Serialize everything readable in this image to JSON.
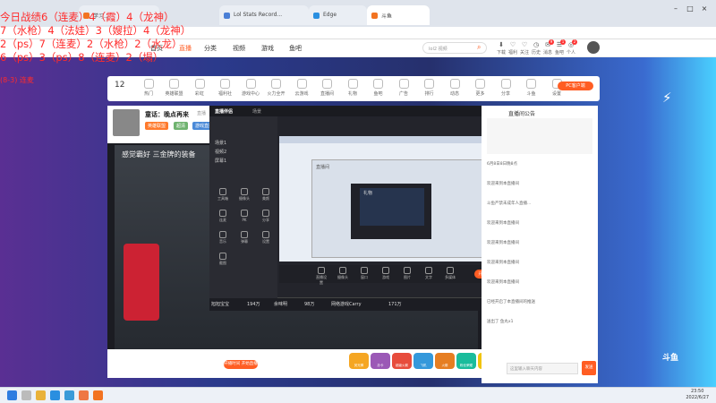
{
  "browser": {
    "tabs": [
      {
        "label": "学习..."
      },
      {
        "label": "Lol Stats Record..."
      },
      {
        "label": "Edge"
      },
      {
        "label": "斗鱼"
      }
    ]
  },
  "site_header": {
    "nav": [
      "首页",
      "直播",
      "分类",
      "视频",
      "游戏",
      "鱼吧"
    ],
    "search_placeholder": "lol2 视频",
    "icons": [
      {
        "label": "下载",
        "glyph": "⬇",
        "badge": ""
      },
      {
        "label": "福利",
        "glyph": "♡",
        "badge": ""
      },
      {
        "label": "关注",
        "glyph": "♡",
        "badge": ""
      },
      {
        "label": "历史",
        "glyph": "◷",
        "badge": ""
      },
      {
        "label": "消息",
        "glyph": "✉",
        "badge": "9"
      },
      {
        "label": "鱼吧",
        "glyph": "☰",
        "badge": "1"
      },
      {
        "label": "个人",
        "glyph": "◎",
        "badge": "2"
      }
    ]
  },
  "category_strip": {
    "count": "12",
    "items": [
      "热门",
      "英雄联盟",
      "彩虹",
      "福利社",
      "游戏中心",
      "火力全开",
      "云游戏",
      "直播间",
      "礼物",
      "鱼吧",
      "广告",
      "排行",
      "动态",
      "更多",
      "分享",
      "斗鱼",
      "设置"
    ],
    "pc_button": "PC客户端"
  },
  "anchor": {
    "name": "童话：晚点再来",
    "room": "直播",
    "follow": "关注",
    "tags": [
      "英雄联盟",
      "超清",
      "游戏直播"
    ]
  },
  "video": {
    "banner_text": "感觉霸好 三金牌的装备"
  },
  "overlay_app": {
    "title": "直播伴侣",
    "scene": "场景",
    "menu": [
      "场景1",
      "视频2",
      "屏幕1"
    ],
    "tools": [
      "工具箱",
      "摄像头",
      "美颜",
      "连麦",
      "PK",
      "分享",
      "音乐",
      "弹幕",
      "设置",
      "截图"
    ],
    "bottom_tools": [
      "直播设置",
      "摄像头",
      "窗口",
      "游戏",
      "图片",
      "文字",
      "多媒体"
    ],
    "start_live": "开始直播",
    "mini_labels": [
      "直播间",
      "礼物"
    ]
  },
  "stats_row": {
    "items": [
      "旭旭宝宝",
      "194万",
      "余味明",
      "98万",
      "网络游戏Carry",
      "171万"
    ]
  },
  "gift_bar": {
    "items": [
      "荧光棒",
      "办卡",
      "超级火箭",
      "飞机",
      "火箭",
      "粉丝荣耀",
      "鱼丸",
      "鱼翅",
      "礼物"
    ],
    "hint": "开播时间 开始直播"
  },
  "chat": {
    "header": "直播间公告",
    "lines": [
      "6月8日8日晚8点",
      "欢迎来到本直播间",
      "斗鱼严禁未成年人直播...",
      "欢迎来到本直播间",
      "欢迎来到本直播间",
      "欢迎来到本直播间",
      "欢迎来到本直播间",
      "已经开启了本直播间的推送",
      "送出了 鱼丸x1"
    ],
    "input_placeholder": "这里输入聊天内容",
    "send": "发送"
  },
  "red_overlay": {
    "lines": [
      "今日战绩6（连麦）4（霞）4（龙神）",
      "7（水枪）4（法娃）3（嫂拉）4（龙神）",
      "2（ps）7（连麦）2（水枪）2（水龙）",
      "6（ps）3（ps）8（连麦）2（塌）",
      "(8-3) 连麦"
    ]
  },
  "taskbar": {
    "time": "23:50",
    "date": "2022/6/27"
  },
  "colors": {
    "accent": "#ff5d23",
    "red_text": "#ff2b2b"
  }
}
